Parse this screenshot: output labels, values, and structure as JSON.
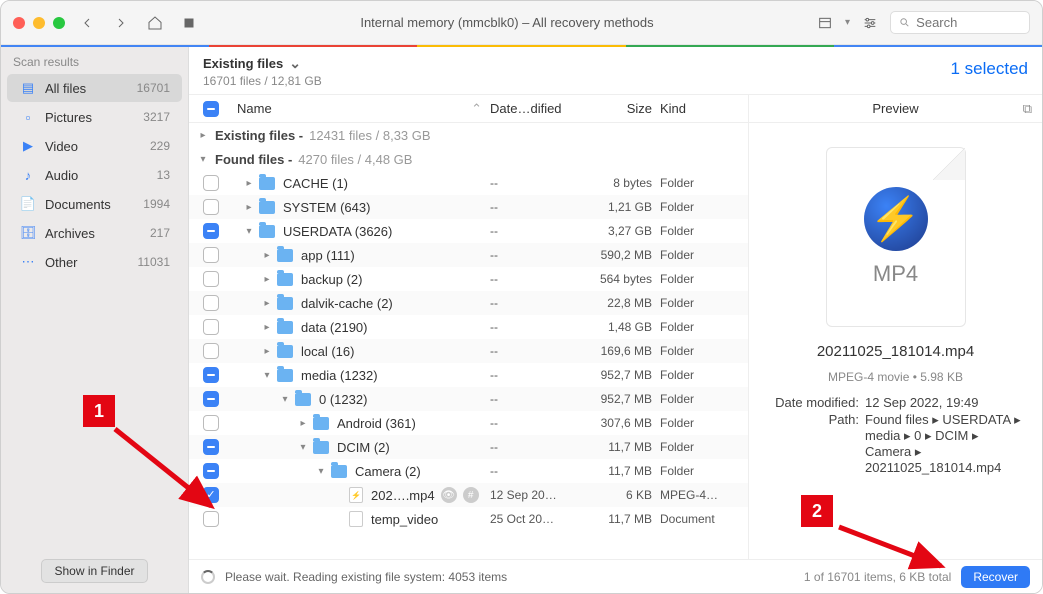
{
  "window_title": "Internal memory (mmcblk0) – All recovery methods",
  "search_placeholder": "Search",
  "sidebar": {
    "heading": "Scan results",
    "items": [
      {
        "icon": "files",
        "label": "All files",
        "count": "16701",
        "active": true
      },
      {
        "icon": "pictures",
        "label": "Pictures",
        "count": "3217"
      },
      {
        "icon": "video",
        "label": "Video",
        "count": "229"
      },
      {
        "icon": "audio",
        "label": "Audio",
        "count": "13"
      },
      {
        "icon": "documents",
        "label": "Documents",
        "count": "1994"
      },
      {
        "icon": "archives",
        "label": "Archives",
        "count": "217"
      },
      {
        "icon": "other",
        "label": "Other",
        "count": "11031"
      }
    ],
    "footer_button": "Show in Finder"
  },
  "main": {
    "title": "Existing files",
    "subtitle": "16701 files / 12,81 GB",
    "selected_label": "1 selected"
  },
  "columns": {
    "name": "Name",
    "date": "Date…dified",
    "size": "Size",
    "kind": "Kind"
  },
  "groups": [
    {
      "name": "Existing files",
      "info": "12431 files / 8,33 GB",
      "disclosure": "right"
    },
    {
      "name": "Found files",
      "info": "4270 files / 4,48 GB",
      "disclosure": "down"
    }
  ],
  "rows": [
    {
      "chk": "",
      "indent": 0,
      "disc": "right",
      "icon": "folder",
      "name": "CACHE (1)",
      "date": "--",
      "size": "8 bytes",
      "kind": "Folder"
    },
    {
      "chk": "",
      "indent": 0,
      "disc": "right",
      "icon": "folder",
      "name": "SYSTEM (643)",
      "date": "--",
      "size": "1,21 GB",
      "kind": "Folder"
    },
    {
      "chk": "some",
      "indent": 0,
      "disc": "down",
      "icon": "folder",
      "name": "USERDATA (3626)",
      "date": "--",
      "size": "3,27 GB",
      "kind": "Folder"
    },
    {
      "chk": "",
      "indent": 1,
      "disc": "right",
      "icon": "folder",
      "name": "app (111)",
      "date": "--",
      "size": "590,2 MB",
      "kind": "Folder"
    },
    {
      "chk": "",
      "indent": 1,
      "disc": "right",
      "icon": "folder",
      "name": "backup (2)",
      "date": "--",
      "size": "564 bytes",
      "kind": "Folder"
    },
    {
      "chk": "",
      "indent": 1,
      "disc": "right",
      "icon": "folder",
      "name": "dalvik-cache (2)",
      "date": "--",
      "size": "22,8 MB",
      "kind": "Folder"
    },
    {
      "chk": "",
      "indent": 1,
      "disc": "right",
      "icon": "folder",
      "name": "data (2190)",
      "date": "--",
      "size": "1,48 GB",
      "kind": "Folder"
    },
    {
      "chk": "",
      "indent": 1,
      "disc": "right",
      "icon": "folder",
      "name": "local (16)",
      "date": "--",
      "size": "169,6 MB",
      "kind": "Folder"
    },
    {
      "chk": "some",
      "indent": 1,
      "disc": "down",
      "icon": "folder",
      "name": "media (1232)",
      "date": "--",
      "size": "952,7 MB",
      "kind": "Folder"
    },
    {
      "chk": "some",
      "indent": 2,
      "disc": "down",
      "icon": "folder",
      "name": "0 (1232)",
      "date": "--",
      "size": "952,7 MB",
      "kind": "Folder"
    },
    {
      "chk": "",
      "indent": 3,
      "disc": "right",
      "icon": "folder",
      "name": "Android (361)",
      "date": "--",
      "size": "307,6 MB",
      "kind": "Folder"
    },
    {
      "chk": "some",
      "indent": 3,
      "disc": "down",
      "icon": "folder",
      "name": "DCIM (2)",
      "date": "--",
      "size": "11,7 MB",
      "kind": "Folder"
    },
    {
      "chk": "some",
      "indent": 4,
      "disc": "down",
      "icon": "folder",
      "name": "Camera (2)",
      "date": "--",
      "size": "11,7 MB",
      "kind": "Folder"
    },
    {
      "chk": "checked",
      "indent": 5,
      "disc": "",
      "icon": "mp4",
      "name": "202….mp4",
      "date": "12 Sep 20…",
      "size": "6 KB",
      "kind": "MPEG-4…",
      "badges": true
    },
    {
      "chk": "",
      "indent": 5,
      "disc": "",
      "icon": "file",
      "name": "temp_video",
      "date": "25 Oct 20…",
      "size": "11,7 MB",
      "kind": "Document"
    }
  ],
  "preview": {
    "heading": "Preview",
    "mp4_label": "MP4",
    "filename": "20211025_181014.mp4",
    "meta": "MPEG-4 movie • 5.98 KB",
    "date_modified_label": "Date modified:",
    "date_modified": "12 Sep 2022, 19:49",
    "path_label": "Path:",
    "path": "Found files ▸ USERDATA ▸ media ▸ 0 ▸ DCIM ▸ Camera ▸ 20211025_181014.mp4"
  },
  "footer": {
    "status": "Please wait. Reading existing file system: 4053 items",
    "summary": "1 of 16701 items, 6 KB total",
    "recover": "Recover"
  },
  "annotations": {
    "c1": "1",
    "c2": "2"
  }
}
